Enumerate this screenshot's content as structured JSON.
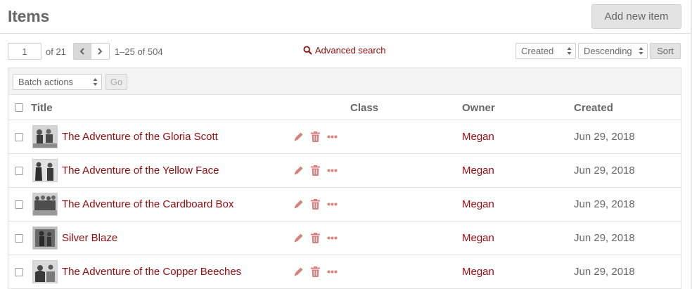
{
  "header": {
    "title": "Items",
    "add_button_label": "Add new item"
  },
  "pagination": {
    "page_value": "1",
    "of_pages": "of 21",
    "range_text": "1–25 of 504"
  },
  "advanced_search_label": "Advanced search",
  "sort": {
    "field_selected": "Created",
    "order_selected": "Descending",
    "sort_button_label": "Sort"
  },
  "batch": {
    "selected": "Batch actions",
    "go_label": "Go"
  },
  "columns": {
    "title": "Title",
    "class": "Class",
    "owner": "Owner",
    "created": "Created"
  },
  "rows": [
    {
      "title": "The Adventure of the Gloria Scott",
      "class": "",
      "owner": "Megan",
      "created": "Jun 29, 2018"
    },
    {
      "title": "The Adventure of the Yellow Face",
      "class": "",
      "owner": "Megan",
      "created": "Jun 29, 2018"
    },
    {
      "title": "The Adventure of the Cardboard Box",
      "class": "",
      "owner": "Megan",
      "created": "Jun 29, 2018"
    },
    {
      "title": "Silver Blaze",
      "class": "",
      "owner": "Megan",
      "created": "Jun 29, 2018"
    },
    {
      "title": "The Adventure of the Copper Beeches",
      "class": "",
      "owner": "Megan",
      "created": "Jun 29, 2018"
    }
  ],
  "colors": {
    "link": "#920b0b",
    "action_icon": "#d9807a",
    "text": "#676767",
    "border": "#dfdfdf"
  }
}
